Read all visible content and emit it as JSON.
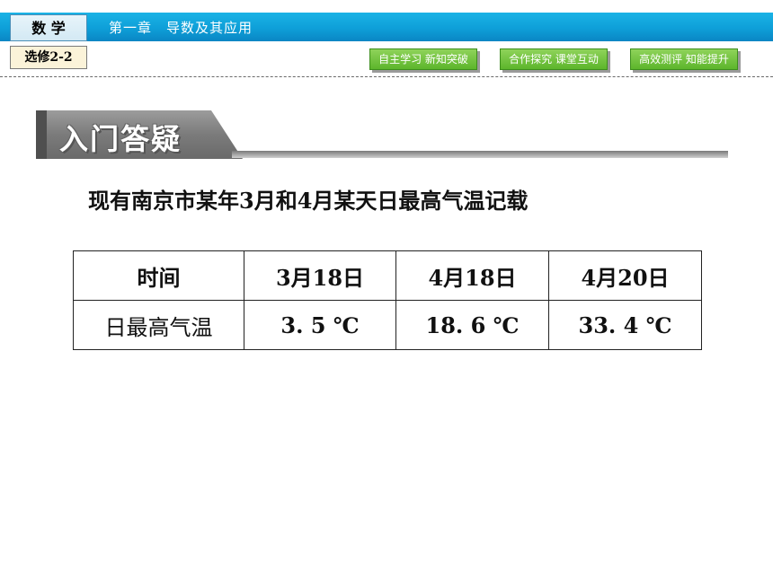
{
  "header": {
    "subject": "数 学",
    "elective": "选修2-2",
    "chapter": "第一章　导数及其应用",
    "nav": [
      "自主学习 新知突破",
      "合作探究 课堂互动",
      "高效测评 知能提升"
    ]
  },
  "section": {
    "title": "入门答疑"
  },
  "intro_text": "现有南京市某年3月和4月某天日最高气温记载",
  "table": {
    "headers": [
      "时间",
      "3月18日",
      "4月18日",
      "4月20日"
    ],
    "row": [
      "日最高气温",
      "3. 5 ℃",
      "18. 6 ℃",
      "33. 4 ℃"
    ]
  },
  "colors": {
    "topbar": "#0e9fd8",
    "nav_green": "#5cb52b",
    "section_gray": "#7a7a7a"
  }
}
